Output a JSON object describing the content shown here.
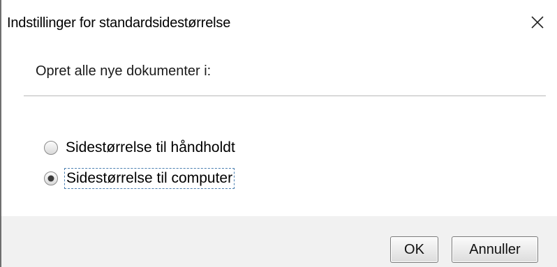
{
  "window": {
    "title": "Indstillinger for standardsidestørrelse",
    "close_icon": "close-icon"
  },
  "content": {
    "heading": "Opret alle nye dokumenter i:",
    "options": [
      {
        "label": "Sidestørrelse til håndholdt",
        "selected": false
      },
      {
        "label": "Sidestørrelse til computer",
        "selected": true
      }
    ]
  },
  "footer": {
    "ok_label": "OK",
    "cancel_label": "Annuller"
  },
  "colors": {
    "footer_bg": "#f1f1f1",
    "focus_border": "#4a7fb0",
    "separator": "#b9b9b9"
  }
}
